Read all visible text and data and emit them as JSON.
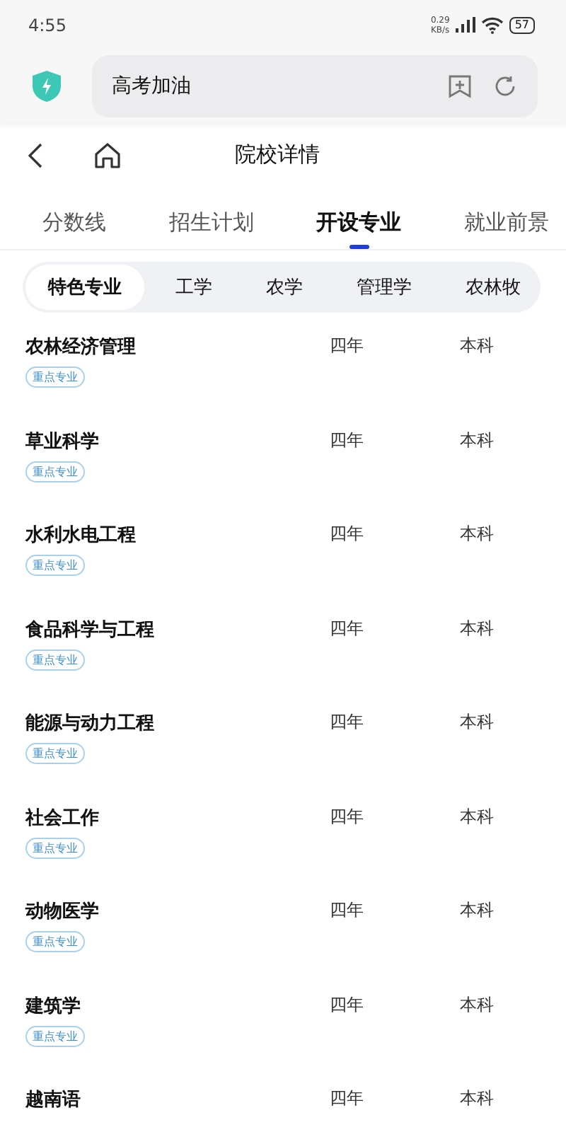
{
  "status_bar": {
    "time": "4:55",
    "speed_value": "0.29",
    "speed_unit": "KB/s",
    "battery": "57"
  },
  "browser_bar": {
    "address": "高考加油"
  },
  "nav": {
    "title": "院校详情"
  },
  "tabs": [
    {
      "label": "分数线",
      "selected": false
    },
    {
      "label": "招生计划",
      "selected": false
    },
    {
      "label": "开设专业",
      "selected": true
    },
    {
      "label": "就业前景",
      "selected": false
    }
  ],
  "categories": [
    {
      "label": "特色专业",
      "selected": true
    },
    {
      "label": "工学",
      "selected": false
    },
    {
      "label": "农学",
      "selected": false
    },
    {
      "label": "管理学",
      "selected": false
    },
    {
      "label": "农林牧",
      "selected": false
    }
  ],
  "majors": [
    {
      "name": "农林经济管理",
      "duration": "四年",
      "level": "本科",
      "badge": "重点专业"
    },
    {
      "name": "草业科学",
      "duration": "四年",
      "level": "本科",
      "badge": "重点专业"
    },
    {
      "name": "水利水电工程",
      "duration": "四年",
      "level": "本科",
      "badge": "重点专业"
    },
    {
      "name": "食品科学与工程",
      "duration": "四年",
      "level": "本科",
      "badge": "重点专业"
    },
    {
      "name": "能源与动力工程",
      "duration": "四年",
      "level": "本科",
      "badge": "重点专业"
    },
    {
      "name": "社会工作",
      "duration": "四年",
      "level": "本科",
      "badge": "重点专业"
    },
    {
      "name": "动物医学",
      "duration": "四年",
      "level": "本科",
      "badge": "重点专业"
    },
    {
      "name": "建筑学",
      "duration": "四年",
      "level": "本科",
      "badge": "重点专业"
    },
    {
      "name": "越南语",
      "duration": "四年",
      "level": "本科"
    }
  ]
}
